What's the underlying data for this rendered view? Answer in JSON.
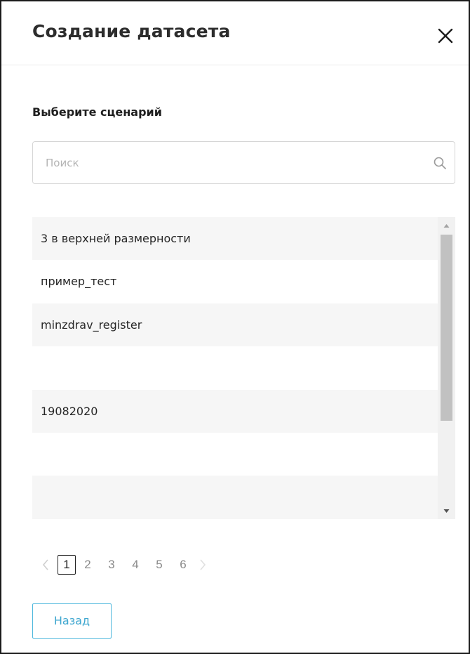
{
  "dialog": {
    "title": "Создание датасета",
    "close_icon": "close-icon"
  },
  "scenario_section": {
    "label": "Выберите сценарий"
  },
  "search": {
    "placeholder": "Поиск",
    "value": "",
    "icon": "search-icon"
  },
  "list": {
    "items": [
      {
        "label": "3 в верхней размерности"
      },
      {
        "label": "пример_тест"
      },
      {
        "label": "minzdrav_register"
      },
      {
        "label": ""
      },
      {
        "label": "19082020"
      },
      {
        "label": ""
      },
      {
        "label": ""
      }
    ]
  },
  "pagination": {
    "prev_icon": "chevron-left-icon",
    "next_icon": "chevron-right-icon",
    "current": "1",
    "pages": [
      "1",
      "2",
      "3",
      "4",
      "5",
      "6"
    ]
  },
  "footer": {
    "back_label": "Назад"
  },
  "colors": {
    "accent": "#4fb8dd",
    "row_alt": "#f6f6f6",
    "scroll_thumb": "#c1c1c1"
  }
}
